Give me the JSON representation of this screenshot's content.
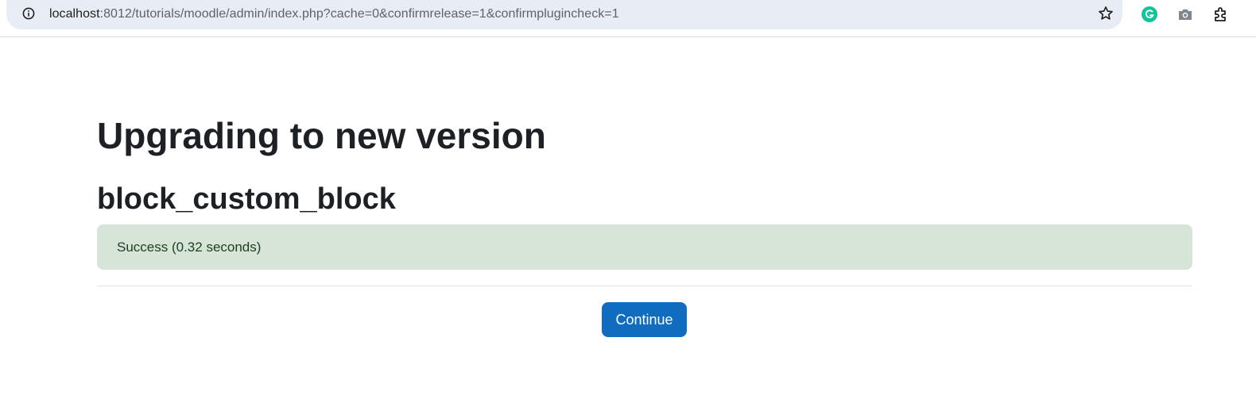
{
  "browser": {
    "url_host": "localhost",
    "url_rest": ":8012/tutorials/moodle/admin/index.php?cache=0&confirmrelease=1&confirmplugincheck=1",
    "icons": [
      "info-icon",
      "star-icon",
      "grammarly-icon",
      "camera-icon",
      "extensions-icon"
    ],
    "colors": {
      "omnibox_bg": "#e8ecf5",
      "grammarly": "#15c39a"
    }
  },
  "main": {
    "page_title": "Upgrading to new version",
    "plugin_name": "block_custom_block",
    "status_message": "Success (0.32 seconds)",
    "continue_label": "Continue"
  },
  "colors": {
    "success_bg": "#d7e4d8",
    "success_text": "#1c3f1f",
    "primary_button": "#0f6cbf",
    "heading_text": "#1d2125"
  }
}
